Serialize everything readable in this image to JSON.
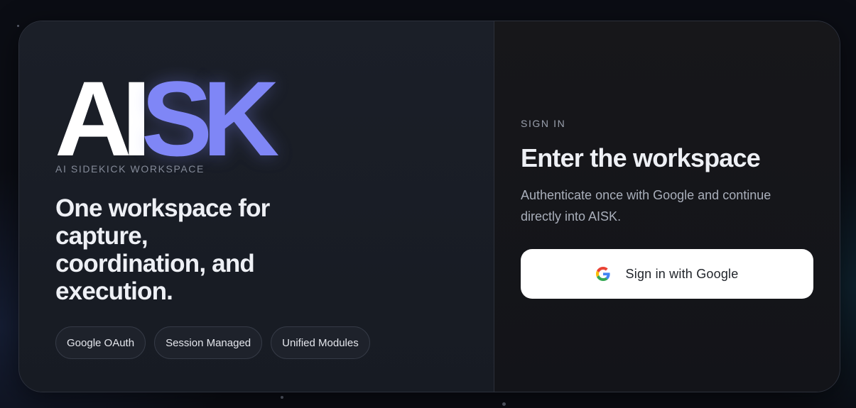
{
  "brand": {
    "logo_part1": "AI",
    "logo_part2": "SK",
    "tagline": "AI SIDEKICK WORKSPACE",
    "accent_color": "#7f86f6"
  },
  "hero": {
    "headline": "One workspace for capture, coordination, and execution."
  },
  "chips": [
    {
      "label": "Google OAuth"
    },
    {
      "label": "Session Managed"
    },
    {
      "label": "Unified Modules"
    }
  ],
  "signin": {
    "eyebrow": "SIGN IN",
    "title": "Enter the workspace",
    "description": "Authenticate once with Google and continue directly into AISK.",
    "button_label": "Sign in with Google",
    "button_icon": "google-icon"
  }
}
